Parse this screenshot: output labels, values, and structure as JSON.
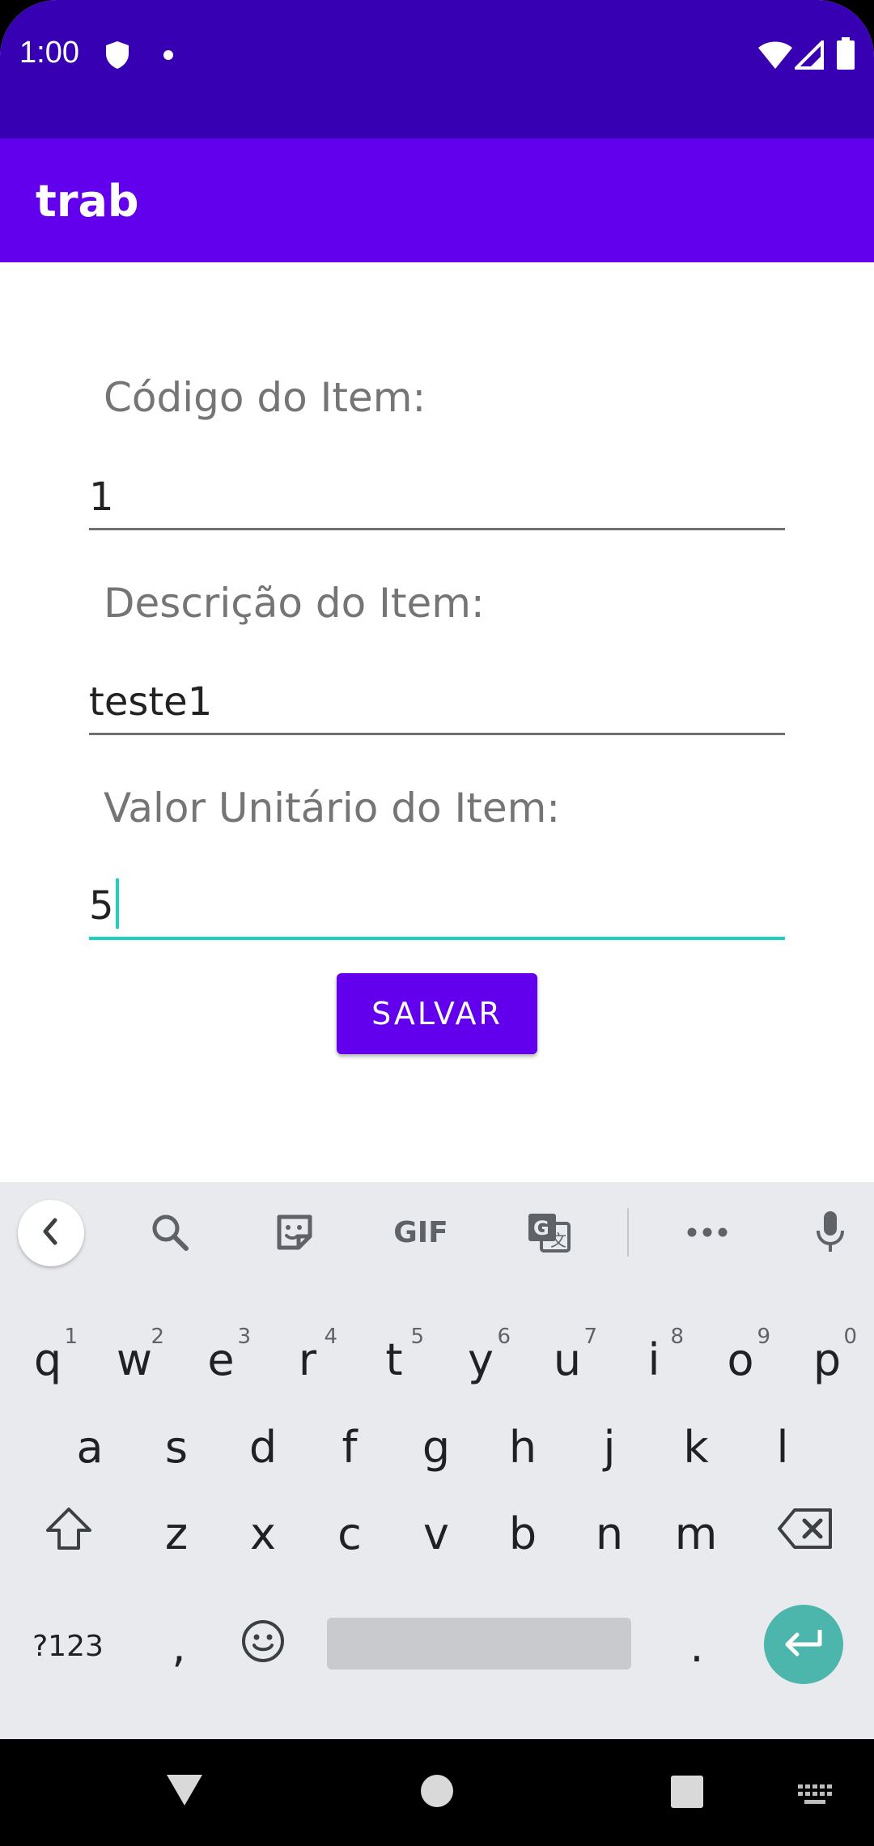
{
  "status_bar": {
    "time": "1:00"
  },
  "app_bar": {
    "title": "trab"
  },
  "form": {
    "code_label": "Código do Item:",
    "code_value": "1",
    "description_label": "Descrição do Item:",
    "description_value": "teste1",
    "price_label": "Valor Unitário do Item:",
    "price_value": "5",
    "save_label": "SALVAR"
  },
  "keyboard": {
    "gif_label": "GIF",
    "row1": [
      {
        "k": "q",
        "h": "1"
      },
      {
        "k": "w",
        "h": "2"
      },
      {
        "k": "e",
        "h": "3"
      },
      {
        "k": "r",
        "h": "4"
      },
      {
        "k": "t",
        "h": "5"
      },
      {
        "k": "y",
        "h": "6"
      },
      {
        "k": "u",
        "h": "7"
      },
      {
        "k": "i",
        "h": "8"
      },
      {
        "k": "o",
        "h": "9"
      },
      {
        "k": "p",
        "h": "0"
      }
    ],
    "row2": [
      "a",
      "s",
      "d",
      "f",
      "g",
      "h",
      "j",
      "k",
      "l"
    ],
    "row3": [
      "z",
      "x",
      "c",
      "v",
      "b",
      "n",
      "m"
    ],
    "symbols_label": "?123",
    "comma_label": ",",
    "period_label": "."
  },
  "colors": {
    "status_bar": "#3700b3",
    "primary": "#6200ee",
    "accent": "#1fcfbf",
    "enter_key": "#4db6ac"
  }
}
